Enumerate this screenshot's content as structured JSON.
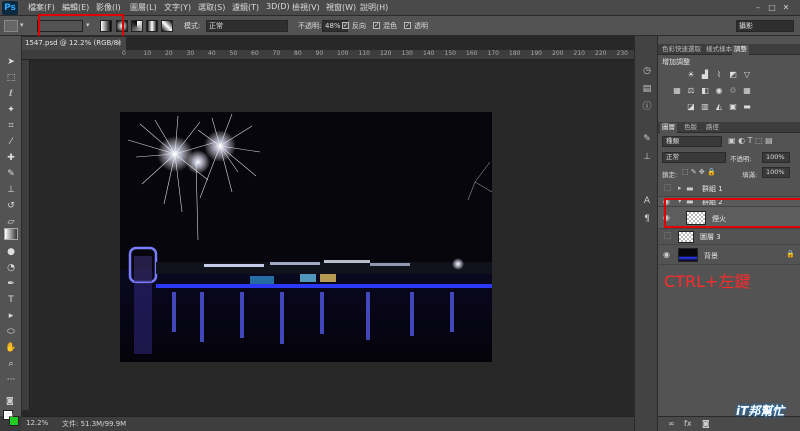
{
  "menubar": {
    "app_logo": "Ps",
    "items": [
      "檔案(F)",
      "編輯(E)",
      "影像(I)",
      "圖層(L)",
      "文字(Y)",
      "選取(S)",
      "濾鏡(T)",
      "3D(D)",
      "檢視(V)",
      "視窗(W)",
      "說明(H)"
    ]
  },
  "optionsbar": {
    "mode_label": "模式:",
    "mode_value": "正常",
    "opacity_label": "不透明:",
    "opacity_value": "48%",
    "reverse_label": "反向",
    "dither_label": "混色",
    "transparency_label": "透明",
    "workspace_value": "攝影"
  },
  "document": {
    "tab_title": "1547.psd @ 12.2% (RGB/8) *",
    "ruler_numbers": [
      "0",
      "10",
      "20",
      "30",
      "40",
      "50",
      "60",
      "70",
      "80",
      "90",
      "100",
      "110",
      "120",
      "130",
      "140",
      "150",
      "160",
      "170",
      "180",
      "190",
      "200",
      "210",
      "220",
      "230"
    ],
    "zoom": "12.2%",
    "status": "文件: 51.3M/99.9M"
  },
  "adjust_panel": {
    "tabs": [
      "色彩快速選取",
      "樣式樣本",
      "調整"
    ],
    "title": "增加調整"
  },
  "layers_panel": {
    "tabs": [
      "圖層",
      "色版",
      "路徑"
    ],
    "filter_value": "種類",
    "blend_value": "正常",
    "opacity_label": "不透明:",
    "opacity_value": "100%",
    "lock_label": "鎖定:",
    "fill_label": "填滿:",
    "fill_value": "100%",
    "layers": [
      {
        "name": "群組 1"
      },
      {
        "name": "群組 2"
      },
      {
        "name": "煙火"
      },
      {
        "name": "圖層 3"
      },
      {
        "name": "背景"
      }
    ]
  },
  "annotation": {
    "ctrl_note": "CTRL+左鍵"
  },
  "brand": {
    "text": "iT邦幫忙"
  },
  "colors": {
    "annotation_red": "#e30000",
    "foreground": "#ffffff",
    "background": "#22cc22"
  }
}
